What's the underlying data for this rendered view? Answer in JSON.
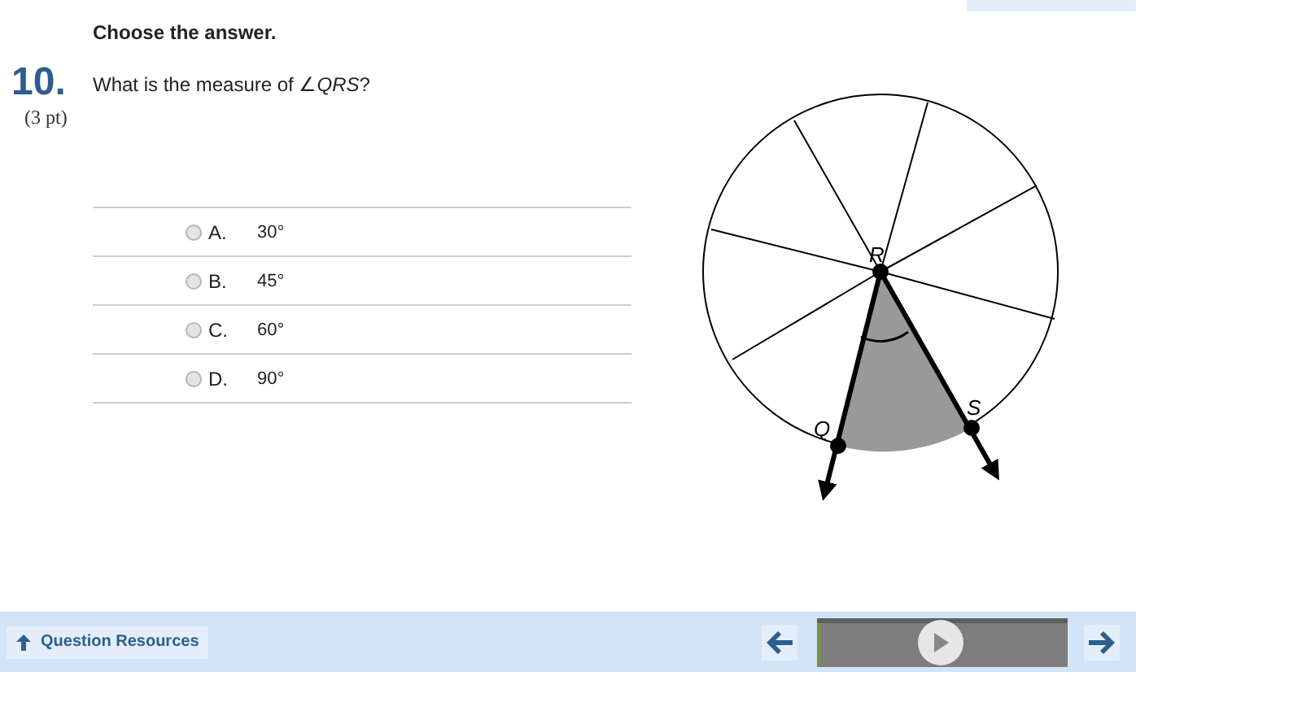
{
  "instruction": "Choose the answer.",
  "question": {
    "number": "10.",
    "points": "(3 pt)",
    "text": "What is the measure of ∠*QRS*?"
  },
  "choices": [
    {
      "letter": "A.",
      "text": "30°",
      "selected": false
    },
    {
      "letter": "B.",
      "text": "45°",
      "selected": false
    },
    {
      "letter": "C.",
      "text": "60°",
      "selected": false
    },
    {
      "letter": "D.",
      "text": "90°",
      "selected": false
    }
  ],
  "diagram": {
    "labels": [
      "R",
      "Q",
      "S"
    ]
  },
  "footer": {
    "resources_button": "Question Resources",
    "player": {
      "level": 0.01
    }
  }
}
